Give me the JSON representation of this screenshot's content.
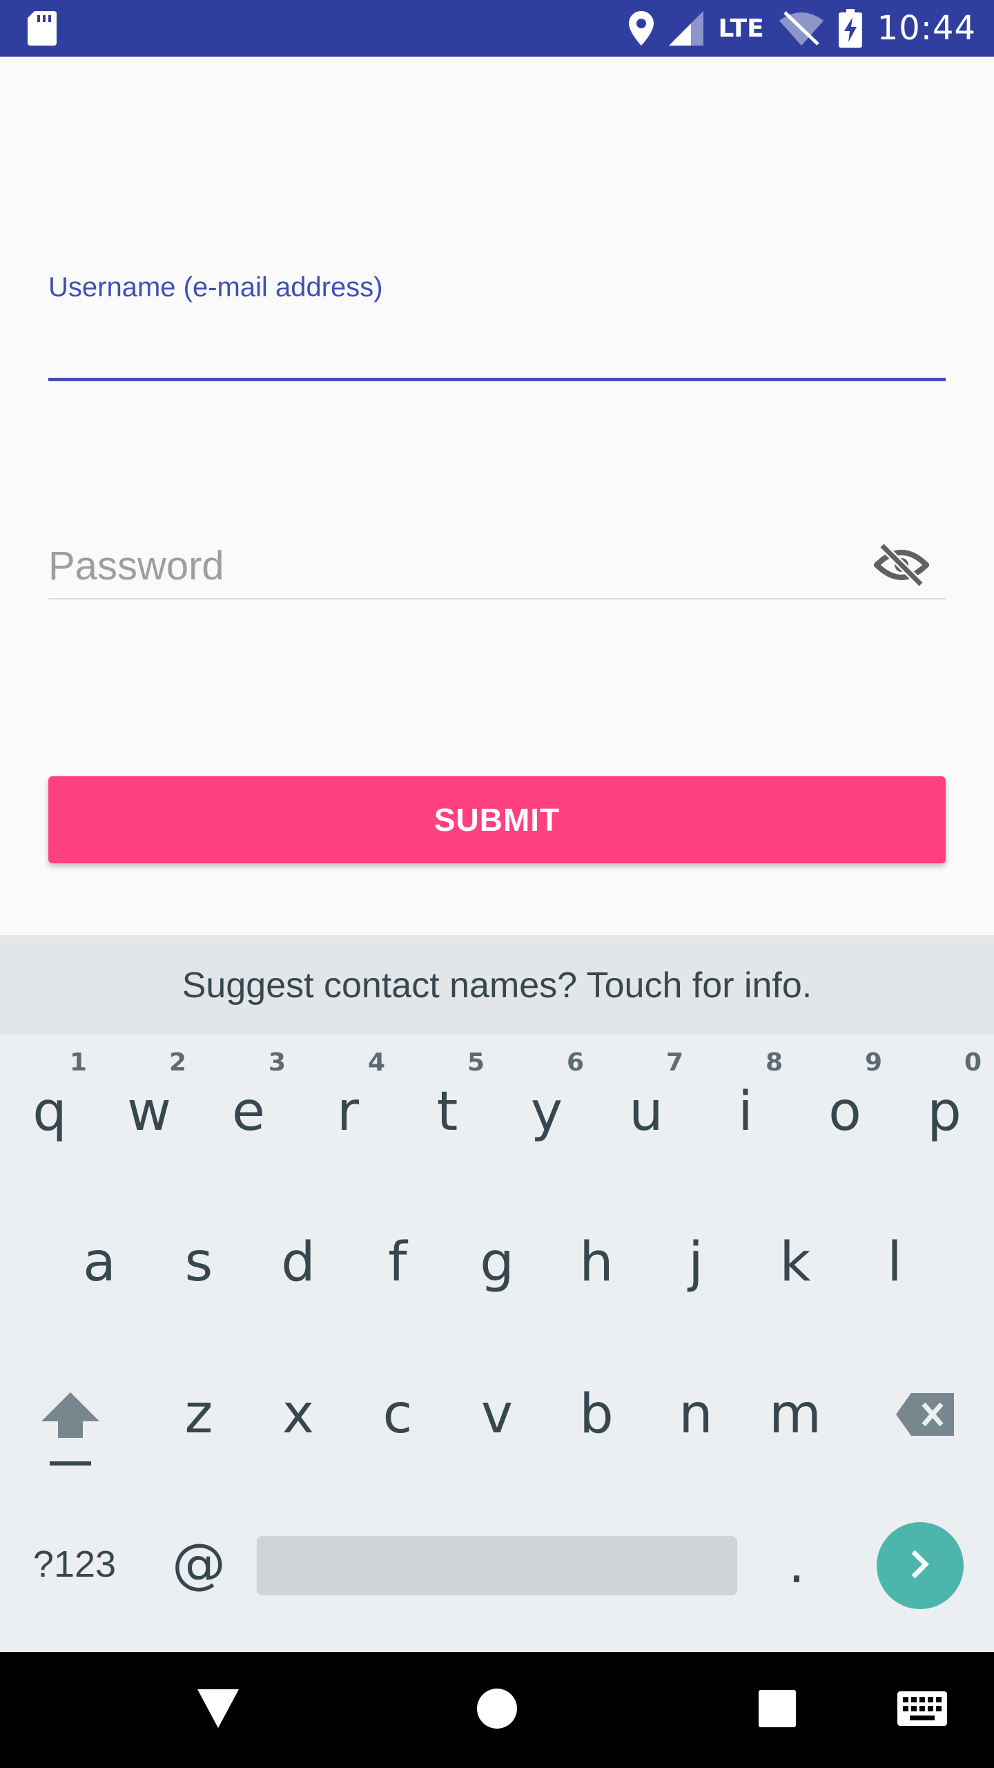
{
  "status_bar": {
    "time": "10:44",
    "network": "LTE",
    "bg_color": "#303f9f",
    "icons": [
      "sd-card-icon",
      "location-icon",
      "signal-icon",
      "wifi-off-icon",
      "battery-charging-icon"
    ]
  },
  "form": {
    "username_label": "Username (e-mail address)",
    "username_value": "",
    "password_placeholder": "Password",
    "password_value": "",
    "submit_label": "SUBMIT",
    "accent_color": "#3f51b5",
    "button_color": "#ff4081"
  },
  "keyboard": {
    "suggestion": "Suggest contact names? Touch for info.",
    "row1": [
      {
        "ch": "q",
        "hint": "1"
      },
      {
        "ch": "w",
        "hint": "2"
      },
      {
        "ch": "e",
        "hint": "3"
      },
      {
        "ch": "r",
        "hint": "4"
      },
      {
        "ch": "t",
        "hint": "5"
      },
      {
        "ch": "y",
        "hint": "6"
      },
      {
        "ch": "u",
        "hint": "7"
      },
      {
        "ch": "i",
        "hint": "8"
      },
      {
        "ch": "o",
        "hint": "9"
      },
      {
        "ch": "p",
        "hint": "0"
      }
    ],
    "row2": [
      "a",
      "s",
      "d",
      "f",
      "g",
      "h",
      "j",
      "k",
      "l"
    ],
    "row3": [
      "z",
      "x",
      "c",
      "v",
      "b",
      "n",
      "m"
    ],
    "symbols_label": "?123",
    "at_label": "@",
    "period_label": ".",
    "enter_color": "#4db6ac"
  },
  "navbar": {
    "buttons": [
      "back-icon",
      "home-icon",
      "recents-icon",
      "keyboard-switch-icon"
    ]
  }
}
